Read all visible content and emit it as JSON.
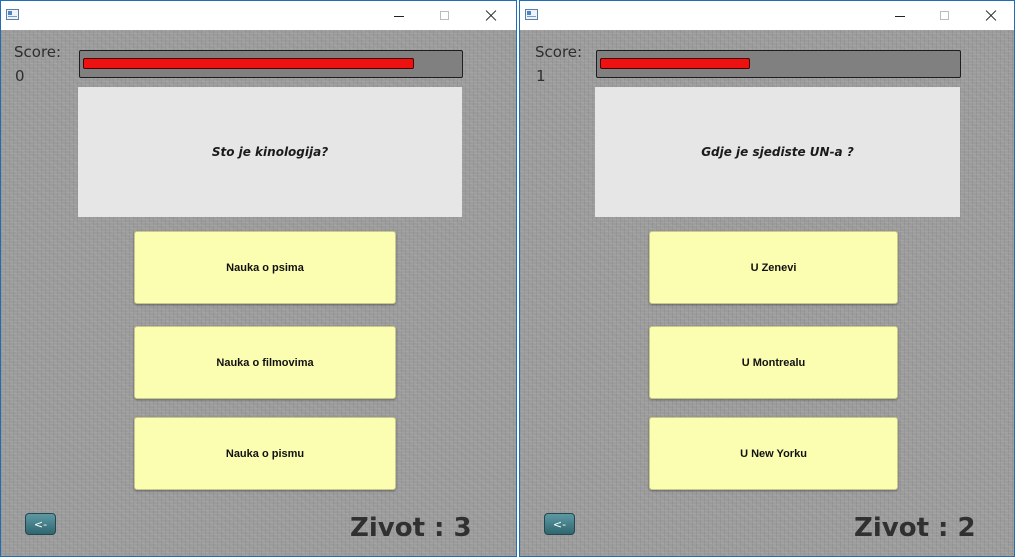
{
  "windows": [
    {
      "score_label": "Score:",
      "score_value": "0",
      "timer_remaining": 0.88,
      "question": "Sto je kinologija?",
      "answers": [
        "Nauka o psima",
        "Nauka o filmovima",
        "Nauka o pismu"
      ],
      "back_label": "<-",
      "lives_text": "Zivot : 3"
    },
    {
      "score_label": "Score:",
      "score_value": "1",
      "timer_remaining": 0.42,
      "question": "Gdje je sjediste UN-a ?",
      "answers": [
        "U Zenevi",
        "U Montrealu",
        "U New Yorku"
      ],
      "back_label": "<-",
      "lives_text": "Zivot : 2"
    }
  ],
  "colors": {
    "timer_fill": "#ee1111",
    "answer_bg": "#fbfdb0",
    "question_bg": "#e6e6e6",
    "back_button": "#3f7a84"
  },
  "icons": {
    "app": "app-window-icon",
    "minimize": "minimize-icon",
    "maximize": "maximize-icon",
    "close": "close-icon"
  }
}
